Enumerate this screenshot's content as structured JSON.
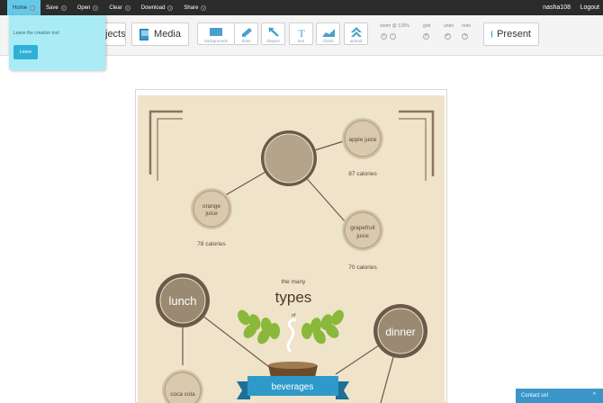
{
  "topbar": {
    "menu": [
      {
        "label": "Home",
        "active": true
      },
      {
        "label": "Save",
        "active": false
      },
      {
        "label": "Open",
        "active": false
      },
      {
        "label": "Clear",
        "active": false
      },
      {
        "label": "Download",
        "active": false
      },
      {
        "label": "Share",
        "active": false
      }
    ],
    "username": "nasha108",
    "logout": "Logout"
  },
  "tooltip": {
    "text": "Leave the creation tool",
    "button": "Leave"
  },
  "toolbar": {
    "objects_label": "jects",
    "media_label": "Media",
    "tools": [
      {
        "label": "backgrounds",
        "icon": "backgrounds-icon"
      },
      {
        "label": "draw",
        "icon": "draw-icon"
      },
      {
        "label": "shapes",
        "icon": "shapes-icon"
      },
      {
        "label": "text",
        "icon": "text-icon"
      },
      {
        "label": "charts",
        "icon": "charts-icon"
      },
      {
        "label": "upload",
        "icon": "upload-icon"
      }
    ],
    "zoom_label": "zoom @ 120%",
    "grid_label": "grid",
    "undo_label": "undo",
    "redo_label": "redo",
    "present_label": "Present"
  },
  "poster": {
    "apple_juice": "apple juice",
    "apple_calories": "87 calories",
    "orange_juice_1": "orange",
    "orange_juice_2": "juice",
    "orange_calories": "78 calories",
    "grapefruit_1": "grapefruit",
    "grapefruit_2": "juice",
    "grapefruit_calories": "70 calories",
    "lunch": "lunch",
    "dinner": "dinner",
    "the_many": "the many",
    "types": "types",
    "of": "of",
    "coca_cola": "coca cola",
    "beverages": "beverages"
  },
  "contact": {
    "label": "Contact us!",
    "toggle": "^"
  },
  "colors": {
    "accent": "#66c8e8",
    "poster_bg": "#efe3c9",
    "badge_dark": "#6b5a4a",
    "badge_fill": "#b5a48c",
    "banner": "#2f9ac9",
    "leaf": "#8ab83a"
  }
}
